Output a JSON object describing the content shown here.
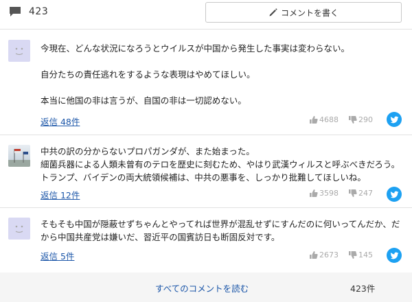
{
  "header": {
    "comment_count": "423",
    "write_button_label": "コメントを書く"
  },
  "comments": [
    {
      "paragraphs": [
        "今現在、どんな状況になろうとウイルスが中国から発生した事実は変わらない。",
        "自分たちの責任逃れをするような表現はやめてほしい。",
        "本当に他国の非は言うが、自国の非は一切認めない。"
      ],
      "reply_label": "返信 48件",
      "likes": "4688",
      "dislikes": "290",
      "avatar": "default-avatar"
    },
    {
      "paragraphs": [
        "中共の訳の分からないプロパガンダが、また始まった。\n細菌兵器による人類未曾有のテロを歴史に刻むため、やはり武漢ウィルスと呼ぶべきだろう。トランプ、バイデンの両大統領候補は、中共の悪事を、しっかり批難してほしいね。"
      ],
      "reply_label": "返信 12件",
      "likes": "3598",
      "dislikes": "247",
      "avatar": "photo-avatar"
    },
    {
      "paragraphs": [
        "そもそも中国が隠蔽せずちゃんとやってれば世界が混乱せずにすんだのに何いってんだか、だから中国共産党は嫌いだ、習近平の国賓訪日も断固反対です。"
      ],
      "reply_label": "返信 5件",
      "likes": "2673",
      "dislikes": "145",
      "avatar": "default-avatar"
    }
  ],
  "footer": {
    "read_all_label": "すべてのコメントを読む",
    "total_count": "423",
    "total_unit": "件"
  },
  "colors": {
    "link": "#1a55a8",
    "twitter": "#1da1f2",
    "avatar_default": "#d9d9f3",
    "footer_bg": "#f5f5f5"
  }
}
